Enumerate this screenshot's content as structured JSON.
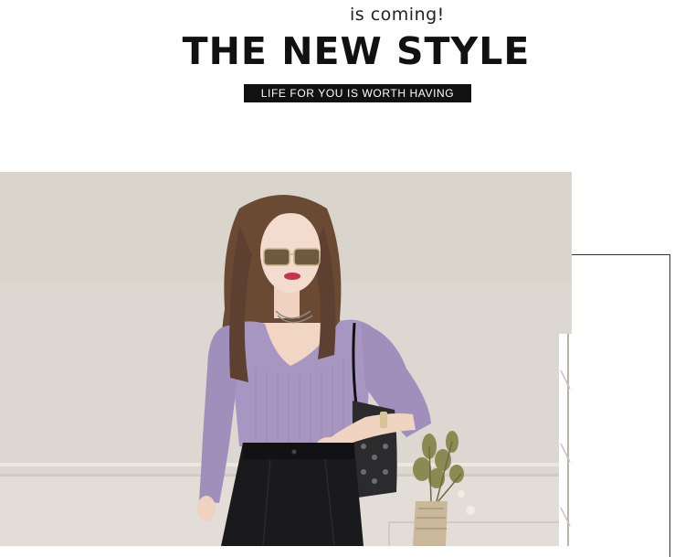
{
  "header": {
    "subtitle": "is coming!",
    "title": "THE NEW STYLE",
    "tagline": "LIFE FOR YOU IS WORTH HAVING"
  },
  "colors": {
    "background": "#ffffff",
    "title_text": "#111111",
    "tagline_bg": "#111111",
    "tagline_text": "#ffffff",
    "wall": "#dcd8d1",
    "top": "#a896c2",
    "pants": "#1a1a1c"
  },
  "photo": {
    "icon": "fashion-model-photo"
  }
}
